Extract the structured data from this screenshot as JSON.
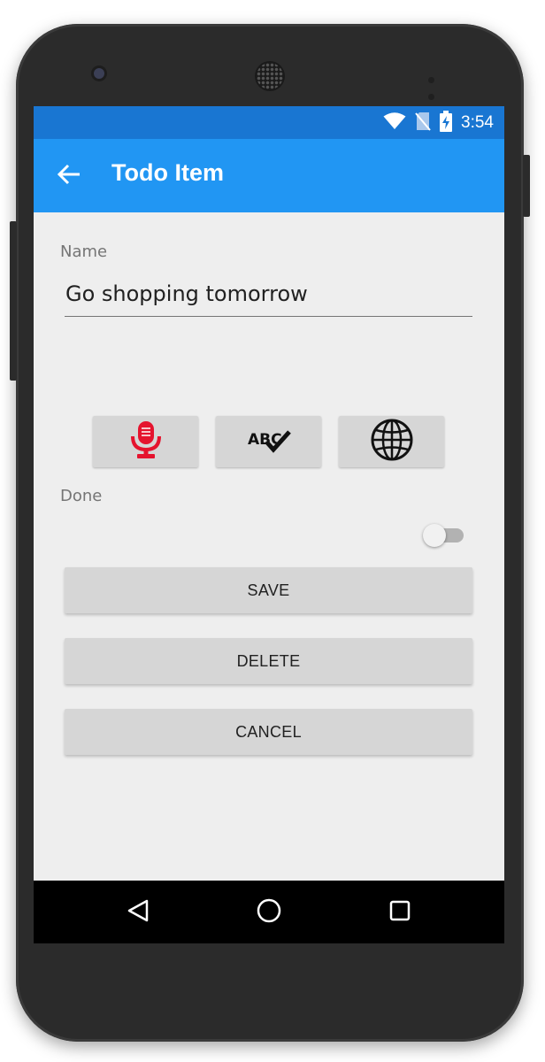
{
  "status_bar": {
    "time": "3:54",
    "icons": [
      "wifi-icon",
      "no-sim-icon",
      "battery-charging-icon"
    ]
  },
  "toolbar": {
    "back_icon": "arrow-back-icon",
    "title": "Todo Item"
  },
  "form": {
    "name_label": "Name",
    "name_value": "Go shopping tomorrow",
    "icon_buttons": [
      "microphone-icon",
      "spellcheck-icon",
      "globe-icon"
    ],
    "done_label": "Done",
    "done_checked": false
  },
  "actions": {
    "save_label": "SAVE",
    "delete_label": "DELETE",
    "cancel_label": "CANCEL"
  },
  "nav_bar": {
    "icons": [
      "nav-back-icon",
      "nav-home-icon",
      "nav-recents-icon"
    ]
  },
  "colors": {
    "status_bar": "#1976d2",
    "toolbar": "#2196f3",
    "background": "#eeeeee",
    "button": "#d6d6d6",
    "mic_red": "#e5132e"
  }
}
